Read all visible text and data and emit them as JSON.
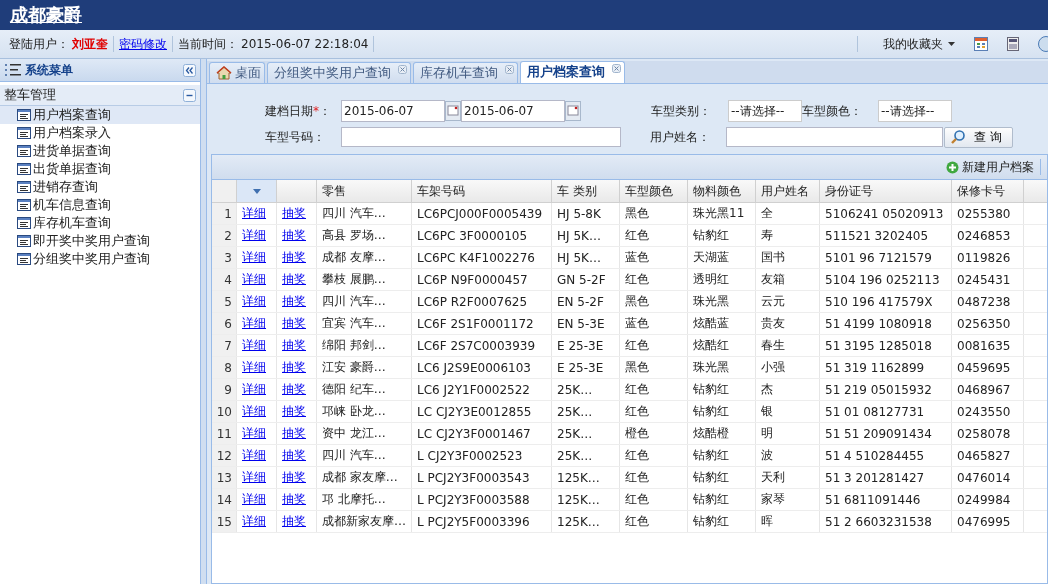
{
  "app_title": "成都豪爵",
  "info_bar": {
    "user_label": "登陆用户：",
    "user_name": "刘亚奎",
    "password_link": "密码修改",
    "time_label": "当前时间：",
    "time": "2015-06-07 22:18:04",
    "favorites": "我的收藏夹"
  },
  "sidebar": {
    "title": "系统菜单",
    "group": {
      "label": "整车管理",
      "expanded": true
    },
    "items": [
      {
        "label": "用户档案查询",
        "selected": true
      },
      {
        "label": "用户档案录入",
        "selected": false
      },
      {
        "label": "进货单据查询",
        "selected": false
      },
      {
        "label": "出货单据查询",
        "selected": false
      },
      {
        "label": "进销存查询",
        "selected": false
      },
      {
        "label": "机车信息查询",
        "selected": false
      },
      {
        "label": "库存机车查询",
        "selected": false
      },
      {
        "label": "即开奖中奖用户查询",
        "selected": false
      },
      {
        "label": "分组奖中奖用户查询",
        "selected": false
      }
    ]
  },
  "tabs": [
    {
      "label": "桌面",
      "kind": "home",
      "selected": false
    },
    {
      "label": "分组奖中奖用户查询",
      "kind": "closable",
      "selected": false
    },
    {
      "label": "库存机车查询",
      "kind": "closable",
      "selected": false
    },
    {
      "label": "用户档案查询",
      "kind": "closable",
      "selected": true
    }
  ],
  "form": {
    "date_label": "建档日期",
    "required_mark": "*",
    "colon": "：",
    "date_from": "2015-06-07",
    "date_to": "2015-06-07",
    "model_code_label": "车型号码：",
    "type_label": "车型类别：",
    "type_value": "--请选择--",
    "color_label": "车型颜色：",
    "color_value": "--请选择--",
    "user_name_label": "用户姓名：",
    "search_button": "查 询"
  },
  "toolbar": {
    "new_button": "新建用户档案"
  },
  "table": {
    "columns": [
      "零售",
      "车架号码",
      "车 类别",
      "车型颜色",
      "物料颜色",
      "用户姓名",
      "身份证号",
      "保修卡号"
    ],
    "rows": [
      {
        "num": "1",
        "detail": "详细",
        "lottery": "抽奖",
        "cells": [
          "四川 汽车…",
          "LC6PCJ000F0005439",
          "HJ 5-8K",
          "黑色",
          "珠光黑11",
          "全",
          "5106241 05020913",
          "0255380"
        ]
      },
      {
        "num": "2",
        "detail": "详细",
        "lottery": "抽奖",
        "cells": [
          "高县 罗场…",
          "LC6PC 3F0000105",
          "HJ 5K…",
          "红色",
          "钻豹红",
          "寿",
          "511521 3202405",
          "0246853"
        ]
      },
      {
        "num": "3",
        "detail": "详细",
        "lottery": "抽奖",
        "cells": [
          "成都 友摩…",
          "LC6PC K4F1002276",
          "HJ 5K…",
          "蓝色",
          "天湖蓝",
          "国书",
          "5101 96 7121579",
          "0119826"
        ]
      },
      {
        "num": "4",
        "detail": "详细",
        "lottery": "抽奖",
        "cells": [
          "攀枝 展鹏…",
          "LC6P N9F0000457",
          "GN 5-2F",
          "红色",
          "透明红",
          "友箱",
          "5104 196 0252113",
          "0245431"
        ]
      },
      {
        "num": "5",
        "detail": "详细",
        "lottery": "抽奖",
        "cells": [
          "四川 汽车…",
          "LC6P R2F0007625",
          "EN 5-2F",
          "黑色",
          "珠光黑",
          "云元",
          "510 196 417579X",
          "0487238"
        ]
      },
      {
        "num": "6",
        "detail": "详细",
        "lottery": "抽奖",
        "cells": [
          "宜宾 汽车…",
          "LC6F 2S1F0001172",
          "EN 5-3E",
          "蓝色",
          "炫酷蓝",
          "贵友",
          "51 4199 1080918",
          "0256350"
        ]
      },
      {
        "num": "7",
        "detail": "详细",
        "lottery": "抽奖",
        "cells": [
          "绵阳 邦剑…",
          "LC6F 2S7C0003939",
          "E 25-3E",
          "红色",
          "炫酷红",
          "春生",
          "51 3195 1285018",
          "0081635"
        ]
      },
      {
        "num": "8",
        "detail": "详细",
        "lottery": "抽奖",
        "cells": [
          "江安 豪爵…",
          "LC6 J2S9E0006103",
          "E 25-3E",
          "黑色",
          "珠光黑",
          "小强",
          "51 319 1162899",
          "0459695"
        ]
      },
      {
        "num": "9",
        "detail": "详细",
        "lottery": "抽奖",
        "cells": [
          "德阳 纪车…",
          "LC6 J2Y1F0002522",
          "25K…",
          "红色",
          "钻豹红",
          "杰",
          "51 219 05015932",
          "0468967"
        ]
      },
      {
        "num": "10",
        "detail": "详细",
        "lottery": "抽奖",
        "cells": [
          "邛崃 卧龙…",
          "LC CJ2Y3E0012855",
          "25K…",
          "红色",
          "钻豹红",
          "银",
          "51 01 08127731",
          "0243550"
        ]
      },
      {
        "num": "11",
        "detail": "详细",
        "lottery": "抽奖",
        "cells": [
          "资中 龙江…",
          "LC CJ2Y3F0001467",
          "25K…",
          "橙色",
          "炫酷橙",
          "明",
          "51 51 209091434",
          "0258078"
        ]
      },
      {
        "num": "12",
        "detail": "详细",
        "lottery": "抽奖",
        "cells": [
          "四川 汽车…",
          "L CJ2Y3F0002523",
          "25K…",
          "红色",
          "钻豹红",
          "波",
          "51 4 510284455",
          "0465827"
        ]
      },
      {
        "num": "13",
        "detail": "详细",
        "lottery": "抽奖",
        "cells": [
          "成都 家友摩…",
          "L PCJ2Y3F0003543",
          "125K…",
          "红色",
          "钻豹红",
          "天利",
          "51 3 201281427",
          "0476014"
        ]
      },
      {
        "num": "14",
        "detail": "详细",
        "lottery": "抽奖",
        "cells": [
          "邛 北摩托…",
          "L PCJ2Y3F0003588",
          "125K…",
          "红色",
          "钻豹红",
          "家琴",
          "51 6811091446",
          "0249984"
        ]
      },
      {
        "num": "15",
        "detail": "详细",
        "lottery": "抽奖",
        "cells": [
          "成都新家友摩…",
          "L PCJ2Y5F0003396",
          "125K…",
          "红色",
          "钻豹红",
          "晖",
          "51 2 6603231538",
          "0476995"
        ]
      }
    ]
  }
}
